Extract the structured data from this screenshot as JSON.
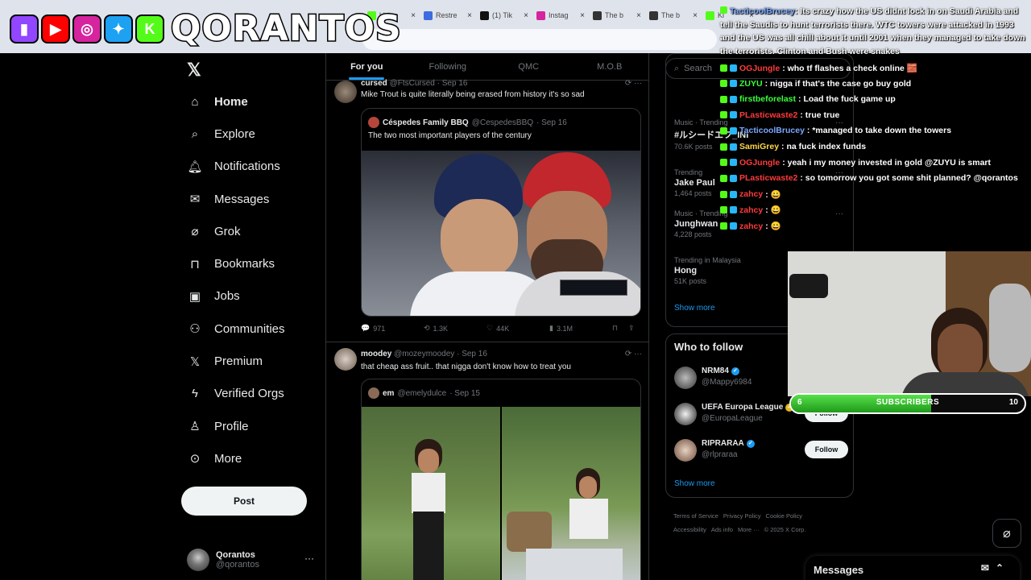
{
  "browser": {
    "tabs": [
      {
        "label": "kick.c",
        "color": "#53fc18"
      },
      {
        "label": "Restre",
        "color": "#3b6de0"
      },
      {
        "label": "(1) Tik",
        "color": "#111111"
      },
      {
        "label": "Instag",
        "color": "#d6249f"
      },
      {
        "label": "The b",
        "color": "#333333"
      },
      {
        "label": "The b",
        "color": "#333333"
      },
      {
        "label": "Ki",
        "color": "#53fc18"
      }
    ]
  },
  "overlay": {
    "brand": "QORANTOS",
    "social_icons": [
      {
        "name": "twitch-icon",
        "color": "#9146ff",
        "glyph": "▮"
      },
      {
        "name": "youtube-icon",
        "color": "#ff0000",
        "glyph": "▶"
      },
      {
        "name": "instagram-icon",
        "color": "#d6249f",
        "glyph": "◎"
      },
      {
        "name": "twitter-bird-icon",
        "color": "#1da1f2",
        "glyph": "✦"
      },
      {
        "name": "kick-icon",
        "color": "#53fc18",
        "glyph": "K"
      }
    ]
  },
  "nav": {
    "items": [
      {
        "label": "Home",
        "icon": "home-icon"
      },
      {
        "label": "Explore",
        "icon": "search-icon"
      },
      {
        "label": "Notifications",
        "icon": "bell-icon"
      },
      {
        "label": "Messages",
        "icon": "mail-icon"
      },
      {
        "label": "Grok",
        "icon": "grok-icon"
      },
      {
        "label": "Bookmarks",
        "icon": "bookmark-icon"
      },
      {
        "label": "Jobs",
        "icon": "briefcase-icon"
      },
      {
        "label": "Communities",
        "icon": "people-icon"
      },
      {
        "label": "Premium",
        "icon": "x-logo-icon"
      },
      {
        "label": "Verified Orgs",
        "icon": "lightning-icon"
      },
      {
        "label": "Profile",
        "icon": "person-icon"
      },
      {
        "label": "More",
        "icon": "more-circle-icon"
      }
    ],
    "post_label": "Post",
    "account": {
      "name": "Qorantos",
      "handle": "@qorantos"
    }
  },
  "feed": {
    "tabs": [
      "For you",
      "Following",
      "QMC",
      "M.O.B"
    ],
    "tweet1": {
      "name": "cursed",
      "handle": "@FtsCursed",
      "date": "· Sep 16",
      "text": "Mike Trout is quite literally being erased from history it's so sad",
      "quote": {
        "name": "Céspedes Family BBQ",
        "handle": "@CespedesBBQ",
        "date": "· Sep 16",
        "text": "The two most important players of the century"
      },
      "replies": "971",
      "reposts": "1.3K",
      "likes": "44K",
      "views": "3.1M"
    },
    "tweet2": {
      "name": "moodey",
      "handle": "@mozeymoodey",
      "date": "· Sep 16",
      "text": "that cheap ass fruit.. that nigga don't know how to treat you",
      "quote": {
        "name": "em",
        "handle": "@emelydulce",
        "date": "· Sep 15"
      }
    }
  },
  "right": {
    "search_placeholder": "Search",
    "trends": [
      {
        "category": "Music · Trending",
        "title": "#ルシードエフ_INI",
        "count": "70.6K posts"
      },
      {
        "category": "Trending",
        "title": "Jake Paul",
        "count": "1,464 posts"
      },
      {
        "category": "Music · Trending",
        "title": "Junghwan",
        "count": "4,228 posts"
      },
      {
        "category": "Trending in Malaysia",
        "title": "Hong",
        "count": "51K posts"
      }
    ],
    "show_more": "Show more",
    "who_to_follow": {
      "title": "Who to follow",
      "accounts": [
        {
          "name": "NRM84",
          "handle": "@Mappy6984",
          "button": "Follow",
          "verified": "blue"
        },
        {
          "name": "UEFA Europa League",
          "handle": "@EuropaLeague",
          "button": "Follow",
          "verified": "gold"
        },
        {
          "name": "RIPRARAA",
          "handle": "@rlpraraa",
          "button": "Follow",
          "verified": "blue"
        }
      ],
      "show_more": "Show more"
    },
    "footer": [
      "Terms of Service",
      "Privacy Policy",
      "Cookie Policy",
      "Accessibility",
      "Ads info",
      "More ···",
      "© 2025 X Corp."
    ]
  },
  "messages_bar": {
    "label": "Messages"
  },
  "chat": {
    "first": {
      "user": "TacticoolBrucey",
      "text": ": Its crazy how the US didnt lock in on Saudi Arabia and tell the Saudis to hunt terrorists there. WTC towers were attacked in 1993 and the US was all chill about it until 2001 when they managed to take down the terrorists. Clinton and Bush were snakes"
    },
    "lines": [
      {
        "user": "OGJungle",
        "color": "#ff3b3b",
        "text": ": who tf flashes a check online 🧱"
      },
      {
        "user": "ZUYU",
        "color": "#3bff3b",
        "text": ": nigga if that's the case go buy gold"
      },
      {
        "user": "firstbeforelast",
        "color": "#3bff3b",
        "text": ": Load the fuck game up"
      },
      {
        "user": "PLasticwaste2",
        "color": "#ff3b3b",
        "text": ": true true"
      },
      {
        "user": "TacticoolBrucey",
        "color": "#7aa7ff",
        "text": ": *managed to take down the towers"
      },
      {
        "user": "SamiGrey",
        "color": "#ffd84a",
        "text": ": na fuck index funds"
      },
      {
        "user": "OGJungle",
        "color": "#ff3b3b",
        "text": ": yeah i my money invested in gold @ZUYU is smart"
      },
      {
        "user": "PLasticwaste2",
        "color": "#ff3b3b",
        "text": ": so tomorrow you got some shit planned? @qorantos"
      },
      {
        "user": "zahcy",
        "color": "#ff3b3b",
        "text": ": 😀"
      },
      {
        "user": "zahcy",
        "color": "#ff3b3b",
        "text": ": 😀"
      },
      {
        "user": "zahcy",
        "color": "#ff3b3b",
        "text": ": 😀"
      }
    ]
  },
  "subscribers": {
    "label": "SUBSCRIBERS",
    "current": "6",
    "goal": "10",
    "progress": 0.6
  },
  "colors": {
    "accent": "#1d9bf0",
    "kick_green": "#53fc18"
  }
}
